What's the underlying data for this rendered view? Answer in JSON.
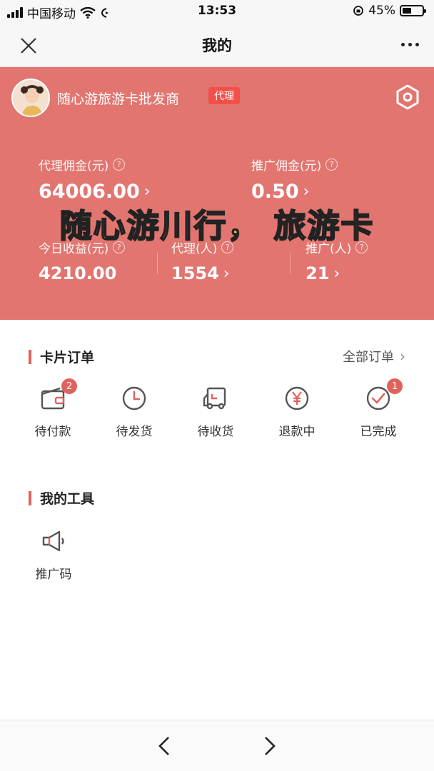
{
  "status_bar": {
    "carrier": "中国移动",
    "time": "13:53",
    "battery_pct_label": "45%",
    "battery_level": 0.45
  },
  "nav": {
    "title": "我的",
    "close_icon": "close-icon",
    "more_icon": "more-dots-icon"
  },
  "profile": {
    "shop_name": "随心游旅游卡批发商",
    "role_badge": "代理",
    "settings_icon": "hexagon-settings-icon"
  },
  "stats": {
    "agent_commission": {
      "label": "代理佣金(元)",
      "value": "64006.00"
    },
    "promo_commission": {
      "label": "推广佣金(元)",
      "value": "0.50"
    },
    "today_income": {
      "label": "今日收益(元)",
      "value": "4210.00"
    },
    "agents": {
      "label": "代理(人)",
      "value": "1554"
    },
    "promoters": {
      "label": "推广(人)",
      "value": "21"
    }
  },
  "caption": "随心游川行， 旅游卡",
  "orders": {
    "title": "卡片订单",
    "all_label": "全部订单",
    "items": [
      {
        "label": "待付款",
        "icon": "wallet-icon",
        "badge": "2"
      },
      {
        "label": "待发货",
        "icon": "clock-icon",
        "badge": ""
      },
      {
        "label": "待收货",
        "icon": "truck-icon",
        "badge": ""
      },
      {
        "label": "退款中",
        "icon": "yen-refund-icon",
        "badge": ""
      },
      {
        "label": "已完成",
        "icon": "check-circle-icon",
        "badge": "1"
      }
    ]
  },
  "tools": {
    "title": "我的工具",
    "items": [
      {
        "label": "推广码",
        "icon": "megaphone-icon"
      }
    ]
  },
  "colors": {
    "header_bg": "#e27570",
    "accent": "#e0625c",
    "caption_yellow": "#f5d61e"
  }
}
